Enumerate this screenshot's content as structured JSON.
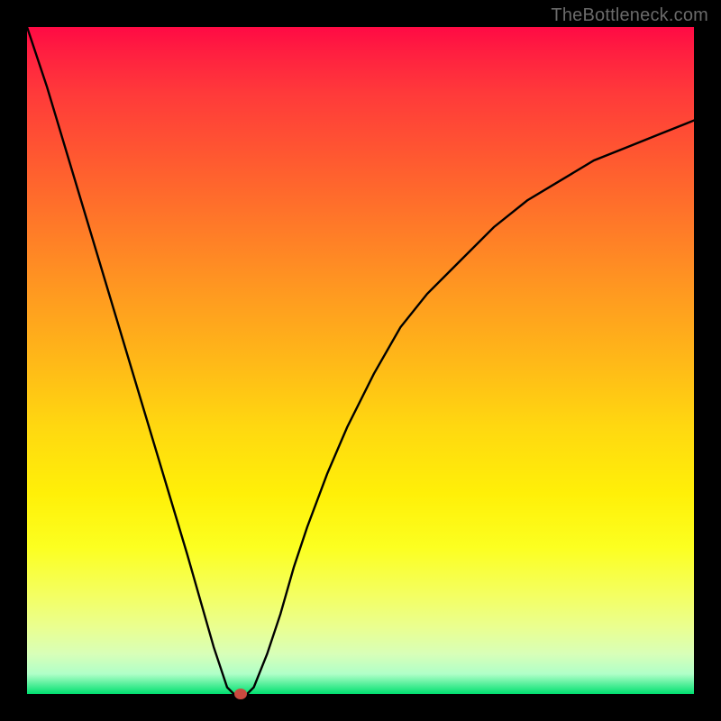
{
  "watermark": "TheBottleneck.com",
  "chart_data": {
    "type": "line",
    "title": "",
    "xlabel": "",
    "ylabel": "",
    "xlim": [
      0,
      100
    ],
    "ylim": [
      0,
      100
    ],
    "grid": false,
    "series": [
      {
        "name": "bottleneck-curve",
        "x": [
          0,
          3,
          6,
          9,
          12,
          15,
          18,
          21,
          24,
          26,
          28,
          30,
          31,
          32,
          33,
          34,
          36,
          38,
          40,
          42,
          45,
          48,
          52,
          56,
          60,
          65,
          70,
          75,
          80,
          85,
          90,
          95,
          100
        ],
        "y": [
          100,
          91,
          81,
          71,
          61,
          51,
          41,
          31,
          21,
          14,
          7,
          1,
          0,
          0,
          0,
          1,
          6,
          12,
          19,
          25,
          33,
          40,
          48,
          55,
          60,
          65,
          70,
          74,
          77,
          80,
          82,
          84,
          86
        ]
      }
    ],
    "annotations": [
      {
        "name": "optimum-point",
        "x": 32,
        "y": 0,
        "color": "#c94a3f"
      }
    ],
    "background": "gradient red-yellow-green (top-to-bottom)"
  }
}
